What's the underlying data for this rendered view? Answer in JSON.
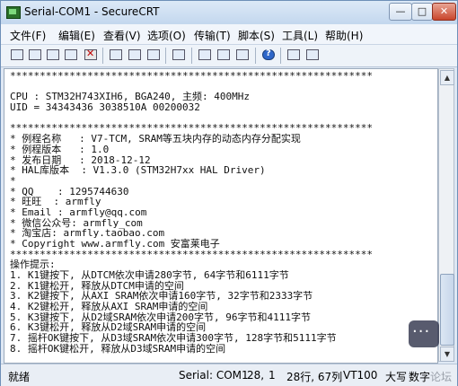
{
  "window": {
    "title": "Serial-COM1 - SecureCRT",
    "minimize_glyph": "—",
    "maximize_glyph": "□",
    "close_glyph": "✕"
  },
  "menu": [
    "文件(F)",
    "编辑(E)",
    "查看(V)",
    "选项(O)",
    "传输(T)",
    "脚本(S)",
    "工具(L)",
    "帮助(H)"
  ],
  "toolbar": [
    {
      "icon": "connect-icon"
    },
    {
      "icon": "quick-connect-icon"
    },
    {
      "icon": "connect-tab-icon"
    },
    {
      "icon": "reconnect-icon"
    },
    {
      "icon": "disconnect-icon"
    },
    {
      "icon": "copy-icon"
    },
    {
      "icon": "paste-icon"
    },
    {
      "icon": "find-icon"
    },
    {
      "icon": "print-icon"
    },
    {
      "icon": "session-options-icon"
    },
    {
      "icon": "global-options-icon"
    },
    {
      "icon": "keymap-icon"
    },
    {
      "icon": "help-icon"
    },
    {
      "icon": "sftp-icon"
    },
    {
      "icon": "more-icon"
    }
  ],
  "terminal": {
    "lines": [
      "*************************************************************",
      "",
      "CPU : STM32H743XIH6, BGA240, 主频: 400MHz",
      "UID = 34343436 3038510A 00200032",
      "",
      "*************************************************************",
      "* 例程名称   : V7-TCM, SRAM等五块内存的动态内存分配实现",
      "* 例程版本   : 1.0",
      "* 发布日期   : 2018-12-12",
      "* HAL库版本  : V1.3.0 (STM32H7xx HAL Driver)",
      "*",
      "* QQ    : 1295744630",
      "* 旺旺  : armfly",
      "* Email : armfly@qq.com",
      "* 微信公众号: armfly_com",
      "* 淘宝店: armfly.taobao.com",
      "* Copyright www.armfly.com 安富莱电子",
      "*************************************************************",
      "操作提示:",
      "1. K1键按下, 从DTCM依次申请280字节, 64字节和6111字节",
      "2. K1键松开, 释放从DTCM申请的空间",
      "3. K2键按下, 从AXI SRAM依次申请160字节, 32字节和2333字节",
      "4. K2键松开, 释放从AXI SRAM申请的空间",
      "5. K3键按下, 从D2域SRAM依次申请200字节, 96字节和4111字节",
      "6. K3键松开, 释放从D2域SRAM申请的空间",
      "7. 摇杆OK键按下, 从D3域SRAM依次申请300字节, 128字节和5111字节",
      "8. 摇杆OK键松开, 释放从D3域SRAM申请的空间"
    ]
  },
  "statusbar": {
    "ready": "就绪",
    "port": "Serial: COM1",
    "row": "28,",
    "col": "1",
    "size": "28行, 67列",
    "terminal": "VT100",
    "caps": "大写",
    "num": "数字"
  },
  "watermark": "论坛"
}
